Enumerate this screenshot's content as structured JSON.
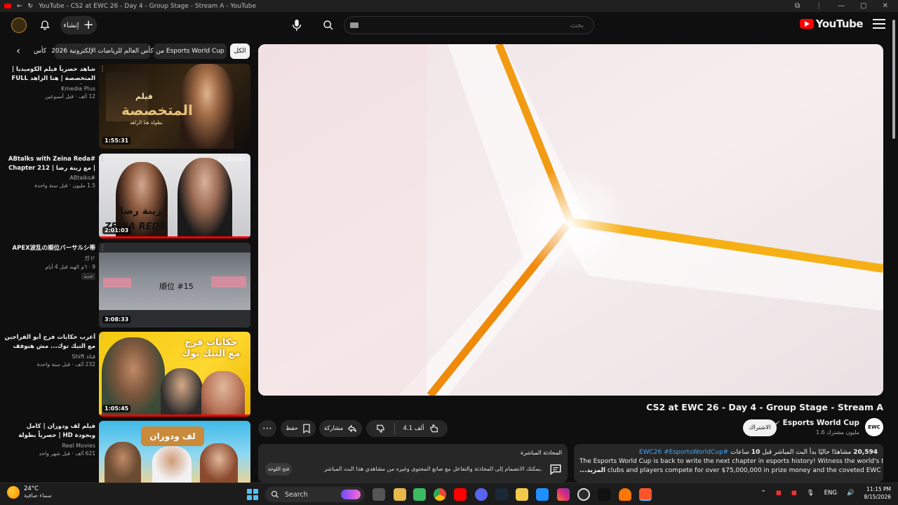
{
  "browser": {
    "tab_title": "YouTube - CS2 at EWC 26 - Day 4 - Group Stage - Stream A - YouTube"
  },
  "header": {
    "logo_text": "YouTube",
    "search_placeholder": "بحث",
    "create_label": "إنشاء"
  },
  "chips": [
    "الكل",
    "من Esports World Cup",
    "كأس العالم للرياضات الإلكترونية 2026",
    "كأس"
  ],
  "recommendations": [
    {
      "title": "شاهد حصرياً فيلم الكوميديا | المتخصصة | هنا الزاهد FULL HD 🎬",
      "channel": "Kmedia Plus",
      "stats": "12 ألف · قبل أسبوعين",
      "duration": "1:55:31",
      "badge": ""
    },
    {
      "title": "#ABtalks with Zeina Reda | مع زينة رضا | Chapter 212",
      "channel": "#ABtalks",
      "stats": "1.5 مليون · قبل سنة واحدة",
      "duration": "2:01:03",
      "badge": ""
    },
    {
      "title": "APEX波乱の順位バーサルシ帯",
      "channel": "ガド",
      "stats": "9 · ٦م الهند قبل 4 أيام",
      "duration": "3:08:33",
      "badge": "جديد"
    },
    {
      "title": "أعرب حكايات فرج أبو الفراجين مع التيك توك... مش هتوقف ضحك 😂",
      "channel": "قناة Shift",
      "stats": "232 ألف · قبل سنة واحدة",
      "duration": "1:05:45",
      "badge": ""
    },
    {
      "title": "فيلم لف ودوران | كامل وبجودة HD | حصرياً بطولة احمد حلمي ودنيا سمير غانم",
      "channel": "Reel Movies",
      "stats": "621 ألف · قبل شهر واحد",
      "duration": "",
      "badge": ""
    }
  ],
  "thumb_texts": {
    "t1_big": "المتخصصة",
    "t1_small": "فيلم",
    "t1_sub": "بطولة هنا الزاهد",
    "t2_ar": "زينة رضا",
    "t2_en": "ZEINA REDA",
    "t2_tag": "#ABtalks",
    "t3_rank": "順位 #15",
    "t4_text": "حكايات فرج مع التيك توك",
    "t5_text": "لف ودوران"
  },
  "video": {
    "title": "CS2 at EWC 26 - Day 4 - Group Stage - Stream A",
    "channel": "Esports World Cup",
    "channel_avatar_text": "EWC",
    "subscribers": "1.6 مليون مشترك",
    "subscribe_label": "الاشتراك",
    "likes": "4.1 ألف",
    "share_label": "مشاركة",
    "save_label": "حفظ"
  },
  "description": {
    "stats_count": "20,594",
    "stats_text": "مشاهدًا حاليًا  بدأ البث المباشر قبل",
    "stats_hours": "10",
    "stats_tail": "ساعات",
    "tags": "#EWC26 #EsportsWorldCup",
    "line1": "The Esports World Cup is back to write the next chapter in esports history! Witness the world's top",
    "line2": "clubs and players compete for over $75,000,000 in prize money and the coveted EWC Club Cha",
    "more": "...المزيد"
  },
  "live_chat": {
    "title": "المحادثة المباشرة",
    "text": "يمكنك الانضمام إلى المحادثة والتفاعل مع صانع المحتوى وغيره من مشاهدي هذا البث المباشر.",
    "open_label": "فتح اللوحة"
  },
  "taskbar": {
    "temp": "24°C",
    "weather": "سماء صافية",
    "search_label": "Search",
    "lang": "ENG",
    "time": "11:15 PM",
    "date": "8/15/2026"
  }
}
